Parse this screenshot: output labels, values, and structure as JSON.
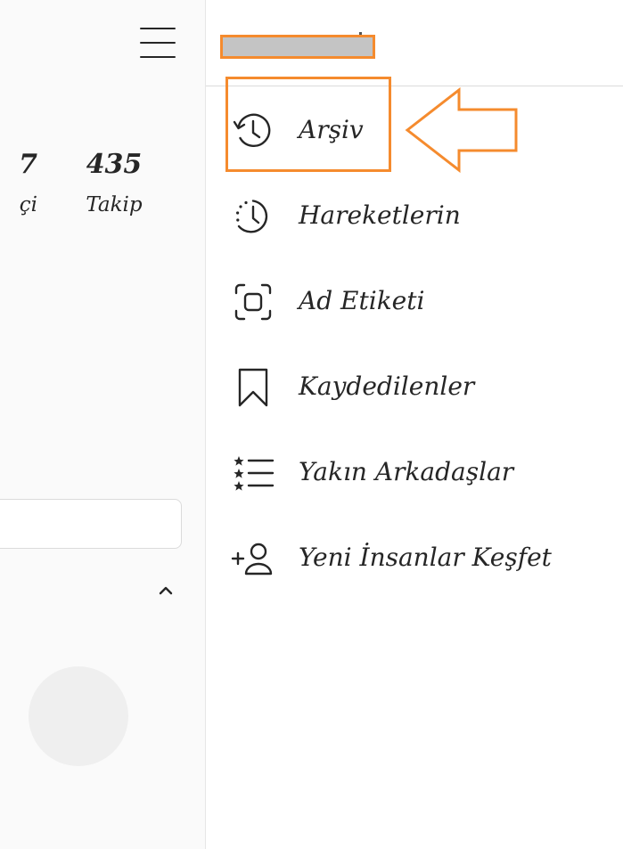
{
  "profile": {
    "stats": {
      "followers": {
        "count": "7",
        "label": "çi"
      },
      "following": {
        "count": "435",
        "label": "Takip"
      }
    }
  },
  "drawer": {
    "menu": [
      {
        "label": "Arşiv",
        "icon": "history-clock-icon"
      },
      {
        "label": "Hareketlerin",
        "icon": "activity-clock-icon"
      },
      {
        "label": "Ad Etiketi",
        "icon": "nametag-scan-icon"
      },
      {
        "label": "Kaydedilenler",
        "icon": "bookmark-icon"
      },
      {
        "label": "Yakın Arkadaşlar",
        "icon": "close-friends-list-icon"
      },
      {
        "label": "Yeni İnsanlar Keşfet",
        "icon": "add-person-icon"
      }
    ]
  },
  "colors": {
    "annotation": "#f58b2e",
    "redaction": "#c4c4c4",
    "text": "#262626",
    "divider": "#dbdbdb"
  }
}
